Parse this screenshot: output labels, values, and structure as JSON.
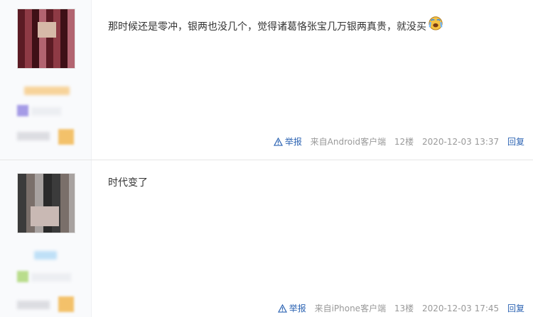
{
  "posts": [
    {
      "content": "那时候还是零冲，银两也没几个，觉得诸葛恪张宝几万银两真贵，就没买",
      "emoji": "crying-face-emoji",
      "report_label": "举报",
      "client": "来自Android客户端",
      "floor": "12楼",
      "time": "2020-12-03 13:37",
      "reply_label": "回复"
    },
    {
      "content": "时代变了",
      "report_label": "举报",
      "client": "来自iPhone客户端",
      "floor": "13楼",
      "time": "2020-12-03 17:45",
      "reply_label": "回复"
    }
  ],
  "colors": {
    "link": "#2d64b3",
    "meta": "#999999",
    "sidebar_bg": "#f9fafc"
  },
  "icons": {
    "report": "warning-triangle-icon"
  }
}
